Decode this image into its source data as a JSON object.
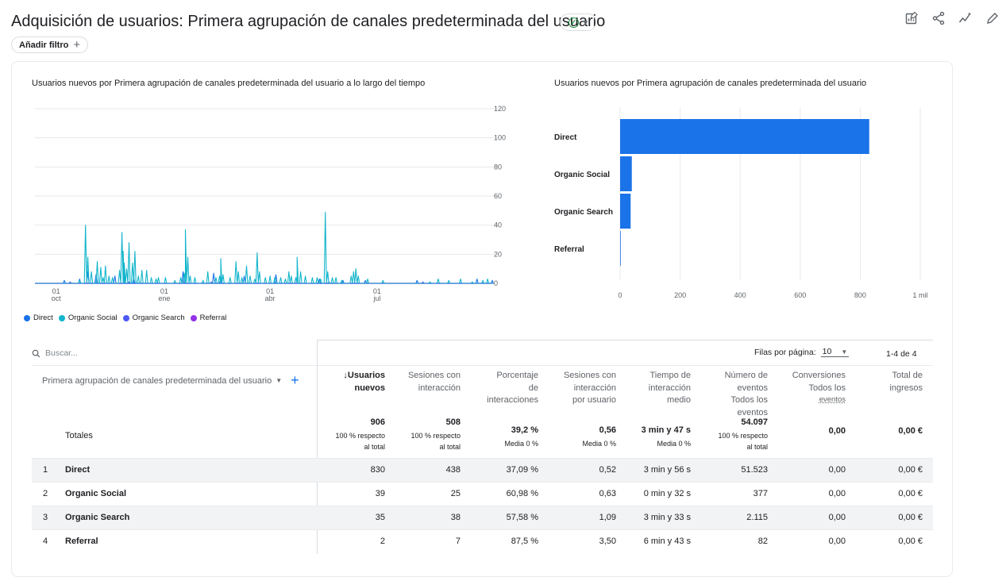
{
  "header": {
    "title": "Adquisición de usuarios: Primera agrupación de canales predeterminada del usuario",
    "add_filter_label": "Añadir filtro",
    "icons": [
      "customize-report-icon",
      "share-icon",
      "insights-icon",
      "edit-icon"
    ]
  },
  "colors": {
    "direct": "#1a73e8",
    "organic_social": "#12b5cb",
    "organic_search": "#4d5af0",
    "referral": "#9334e6"
  },
  "chart_data": [
    {
      "type": "line",
      "title": "Usuarios nuevos por Primera agrupación de canales predeterminada del usuario a lo largo del tiempo",
      "x_ticks": [
        {
          "day": 18,
          "label": "01",
          "sublabel": "oct"
        },
        {
          "day": 110,
          "label": "01",
          "sublabel": "ene"
        },
        {
          "day": 200,
          "label": "01",
          "sublabel": "abr"
        },
        {
          "day": 291,
          "label": "01",
          "sublabel": "jul"
        }
      ],
      "x_range": [
        0,
        389
      ],
      "ylim": [
        0,
        120
      ],
      "y_ticks": [
        "0",
        "20",
        "40",
        "60",
        "80",
        "100",
        "120"
      ],
      "grid": true,
      "legend": [
        "Direct",
        "Organic Social",
        "Organic Search",
        "Referral"
      ],
      "legend_position": "bottom-left",
      "series": [
        {
          "name": "Direct",
          "peaks": [
            [
              25,
              2
            ],
            [
              38,
              3
            ],
            [
              45,
              8
            ],
            [
              52,
              6
            ],
            [
              68,
              5
            ],
            [
              76,
              9
            ],
            [
              84,
              4
            ],
            [
              126,
              8
            ],
            [
              152,
              7
            ],
            [
              158,
              3
            ],
            [
              178,
              5
            ],
            [
              205,
              6
            ],
            [
              222,
              4
            ],
            [
              242,
              3
            ],
            [
              262,
              2
            ],
            [
              281,
              2
            ],
            [
              325,
              2
            ],
            [
              376,
              3
            ],
            [
              389,
              2
            ]
          ]
        },
        {
          "name": "Organic Social",
          "peaks": [
            [
              38,
              2
            ],
            [
              43,
              40
            ],
            [
              45,
              18
            ],
            [
              48,
              8
            ],
            [
              53,
              15
            ],
            [
              56,
              11
            ],
            [
              58,
              4
            ],
            [
              60,
              12
            ],
            [
              63,
              5
            ],
            [
              66,
              4
            ],
            [
              72,
              9
            ],
            [
              74,
              35
            ],
            [
              75,
              22
            ],
            [
              76,
              14
            ],
            [
              78,
              10
            ],
            [
              80,
              28
            ],
            [
              83,
              14
            ],
            [
              85,
              22
            ],
            [
              88,
              5
            ],
            [
              91,
              9
            ],
            [
              95,
              9
            ],
            [
              99,
              4
            ],
            [
              103,
              3
            ],
            [
              105,
              4
            ],
            [
              111,
              4
            ],
            [
              119,
              2
            ],
            [
              124,
              4
            ],
            [
              127,
              7
            ],
            [
              128,
              37
            ],
            [
              130,
              18
            ],
            [
              132,
              5
            ],
            [
              136,
              4
            ],
            [
              143,
              2
            ],
            [
              147,
              8
            ],
            [
              154,
              4
            ],
            [
              157,
              5
            ],
            [
              158,
              17
            ],
            [
              160,
              6
            ],
            [
              166,
              4
            ],
            [
              171,
              15
            ],
            [
              173,
              8
            ],
            [
              176,
              4
            ],
            [
              180,
              12
            ],
            [
              183,
              5
            ],
            [
              187,
              3
            ],
            [
              189,
              21
            ],
            [
              191,
              8
            ],
            [
              196,
              4
            ],
            [
              200,
              5
            ],
            [
              204,
              4
            ],
            [
              209,
              4
            ],
            [
              213,
              3
            ],
            [
              216,
              8
            ],
            [
              218,
              5
            ],
            [
              222,
              4
            ],
            [
              223,
              18
            ],
            [
              226,
              8
            ],
            [
              230,
              5
            ],
            [
              236,
              4
            ],
            [
              240,
              4
            ],
            [
              243,
              3
            ],
            [
              247,
              49
            ],
            [
              249,
              8
            ],
            [
              253,
              4
            ],
            [
              256,
              4
            ],
            [
              261,
              2
            ],
            [
              269,
              5
            ],
            [
              271,
              8
            ],
            [
              273,
              10
            ],
            [
              275,
              5
            ],
            [
              283,
              3
            ],
            [
              296,
              2
            ],
            [
              336,
              1
            ],
            [
              343,
              3
            ],
            [
              352,
              2
            ],
            [
              362,
              3
            ],
            [
              372,
              1
            ],
            [
              381,
              2
            ],
            [
              385,
              3
            ]
          ]
        },
        {
          "name": "Organic Search",
          "peaks": [
            [
              30,
              1
            ],
            [
              80,
              1
            ],
            [
              150,
              1
            ],
            [
              250,
              1
            ],
            [
              330,
              1
            ]
          ]
        },
        {
          "name": "Referral",
          "peaks": []
        }
      ]
    },
    {
      "type": "bar",
      "orientation": "horizontal",
      "title": "Usuarios nuevos por Primera agrupación de canales predeterminada del usuario",
      "categories": [
        "Direct",
        "Organic Social",
        "Organic Search",
        "Referral"
      ],
      "values": [
        830,
        39,
        35,
        2
      ],
      "xlim": [
        0,
        1000
      ],
      "x_ticks": [
        "0",
        "200",
        "400",
        "600",
        "800",
        "1 mil"
      ],
      "grid": true
    }
  ],
  "table": {
    "search_placeholder": "Buscar...",
    "rows_per_page_label": "Filas por página:",
    "rows_per_page_value": "10",
    "page_range": "1-4 de 4",
    "dimension_header": "Primera agrupación de canales predeterminada del usuario",
    "columns": [
      {
        "lines": [
          "↓Usuarios",
          "nuevos"
        ],
        "sorted": true
      },
      {
        "lines": [
          "Sesiones con",
          "interacción"
        ]
      },
      {
        "lines": [
          "Porcentaje",
          "de",
          "interacciones"
        ]
      },
      {
        "lines": [
          "Sesiones con",
          "interacción",
          "por usuario"
        ]
      },
      {
        "lines": [
          "Tiempo de",
          "interacción",
          "medio"
        ]
      },
      {
        "lines": [
          "Número de",
          "eventos",
          "Todos los",
          "eventos"
        ]
      },
      {
        "lines": [
          "Conversiones",
          "Todos los",
          "eventos"
        ]
      },
      {
        "lines": [
          "Total de",
          "ingresos"
        ]
      }
    ],
    "totals_label": "Totales",
    "totals": [
      {
        "value": "906",
        "sub": [
          "100 % respecto",
          "al total"
        ]
      },
      {
        "value": "508",
        "sub": [
          "100 % respecto",
          "al total"
        ]
      },
      {
        "value": "39,2 %",
        "sub": [
          "Media 0 %"
        ]
      },
      {
        "value": "0,56",
        "sub": [
          "Media 0 %"
        ]
      },
      {
        "value": "3 min y 47 s",
        "sub": [
          "Media 0 %"
        ]
      },
      {
        "value": "54.097",
        "sub": [
          "100 % respecto",
          "al total"
        ]
      },
      {
        "value": "0,00",
        "sub": []
      },
      {
        "value": "0,00 €",
        "sub": []
      }
    ],
    "rows": [
      {
        "idx": "1",
        "name": "Direct",
        "values": [
          "830",
          "438",
          "37,09 %",
          "0,52",
          "3 min y 56 s",
          "51.523",
          "0,00",
          "0,00 €"
        ]
      },
      {
        "idx": "2",
        "name": "Organic Social",
        "values": [
          "39",
          "25",
          "60,98 %",
          "0,63",
          "0 min y 32 s",
          "377",
          "0,00",
          "0,00 €"
        ]
      },
      {
        "idx": "3",
        "name": "Organic Search",
        "values": [
          "35",
          "38",
          "57,58 %",
          "1,09",
          "3 min y 33 s",
          "2.115",
          "0,00",
          "0,00 €"
        ]
      },
      {
        "idx": "4",
        "name": "Referral",
        "values": [
          "2",
          "7",
          "87,5 %",
          "3,50",
          "6 min y 43 s",
          "82",
          "0,00",
          "0,00 €"
        ]
      }
    ]
  }
}
